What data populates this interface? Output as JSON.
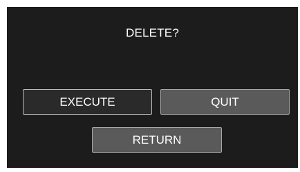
{
  "dialog": {
    "prompt": "DELETE?"
  },
  "buttons": {
    "execute_label": "EXECUTE",
    "quit_label": "QUIT",
    "return_label": "RETURN"
  },
  "colors": {
    "screen_background": "#1c1c1c",
    "text": "#ffffff",
    "button_fill": "#5a5a5a",
    "selected_button_fill": "#2a2a2a"
  }
}
